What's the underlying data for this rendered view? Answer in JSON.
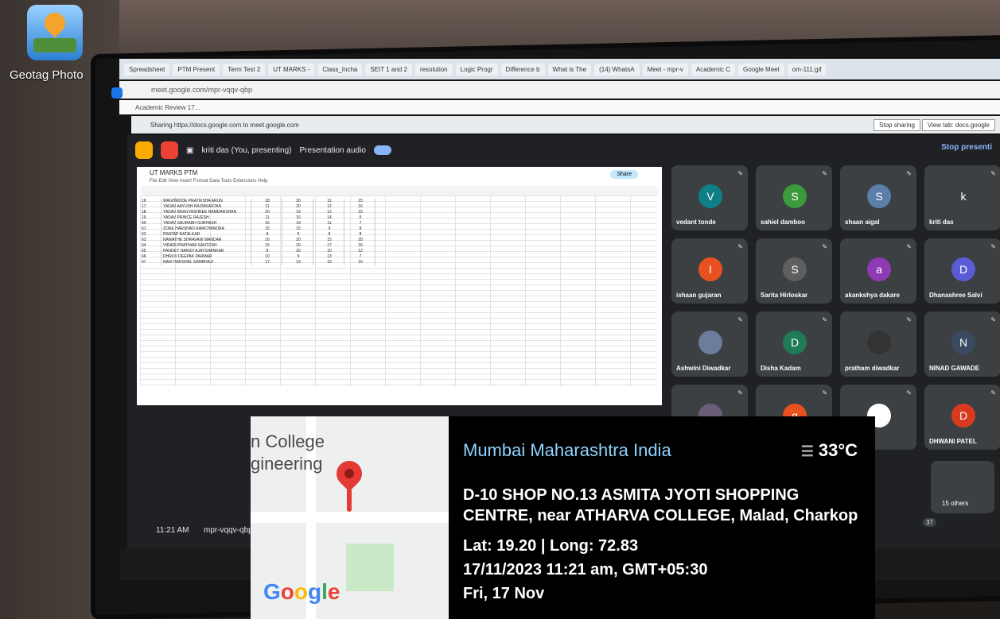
{
  "desktop": {
    "app_label": "Geotag Photo"
  },
  "browser": {
    "tabs": [
      "Spreadsheet",
      "PTM Present",
      "Term Test 2",
      "UT MARKS -",
      "Class_Incha",
      "SEIT 1 and 2",
      "resolution",
      "Logic Progr",
      "Difference b",
      "What is The",
      "(14) WhatsA",
      "Meet - mpr-v",
      "Academic C",
      "Google Meet",
      "om-111.gif"
    ],
    "url": "meet.google.com/mpr-vqqv-qbp",
    "bookmark": "Academic Review 17...",
    "sharing_text": "Sharing https://docs.google.com to meet.google.com",
    "stop_sharing": "Stop sharing",
    "view_tab": "View tab: docs.google"
  },
  "meet": {
    "presenter": "kriti das (You, presenting)",
    "presentation_audio": "Presentation audio",
    "stop_presenting": "Stop presenti",
    "time": "11:21 AM",
    "meeting_code": "mpr-vqqv-qbp",
    "participant_count": "37",
    "others": "15 others",
    "participants": [
      {
        "name": "vedant tonde",
        "initial": "V",
        "color": "#0f7f86"
      },
      {
        "name": "sahiel damboo",
        "initial": "S",
        "color": "#3c9a3c"
      },
      {
        "name": "shaan aigal",
        "initial": "S",
        "color": "#5b7fa8"
      },
      {
        "name": "kriti das",
        "initial": "k",
        "color": "#3c4043"
      },
      {
        "name": "ishaan gujaran",
        "initial": "I",
        "color": "#e8501f"
      },
      {
        "name": "Sarita Hirloskar",
        "initial": "S",
        "color": "#5f5f5f"
      },
      {
        "name": "akankshya dakare",
        "initial": "a",
        "color": "#8e3ab5"
      },
      {
        "name": "Dhanashree Salvi",
        "initial": "D",
        "color": "#5b5bd6"
      },
      {
        "name": "Ashwini Diwadkar",
        "initial": "",
        "color": "#6b7d9a"
      },
      {
        "name": "Disha Kadam",
        "initial": "D",
        "color": "#1f7a55"
      },
      {
        "name": "pratham diwadkar",
        "initial": "",
        "color": "#333333"
      },
      {
        "name": "NINAD GAWADE",
        "initial": "N",
        "color": "#3a4a60"
      },
      {
        "name": "",
        "initial": "",
        "color": "#6b5e7a"
      },
      {
        "name": "",
        "initial": "g",
        "color": "#e8501f"
      },
      {
        "name": "",
        "initial": "",
        "color": "#ffffff"
      },
      {
        "name": "DHWANI PATEL",
        "initial": "D",
        "color": "#d93a1f"
      }
    ]
  },
  "sheet": {
    "title": "UT MARKS PTM",
    "menu": "File  Edit  View  Insert  Format  Data  Tools  Extensions  Help",
    "share": "Share",
    "rows": [
      [
        "16",
        "WAGHMODE PRATIKSHA ARUN",
        "18",
        "20",
        "11",
        "15"
      ],
      [
        "17",
        "YADAV AAYUSH RAJNIKANTAN",
        "11",
        "20",
        "12",
        "16"
      ],
      [
        "18",
        "YADAV BHAGYASHREE RAMDARSHAN",
        "20",
        "19",
        "12",
        "15"
      ],
      [
        "19",
        "YADAV PRINCE RAJESH",
        "11",
        "16",
        "14",
        "5"
      ],
      [
        "60",
        "YADAV SAURABH SUBHASH",
        "16",
        "19",
        "11",
        "7"
      ],
      [
        "61",
        "ZORE HARSHAD RAMCHANDRA",
        "15",
        "15",
        "9",
        "8"
      ],
      [
        "62",
        "PRATAP NATALKAR",
        "8",
        "5",
        "8",
        "8"
      ],
      [
        "63",
        "NAWATHE SHRAVANI MANDAR",
        "16",
        "20",
        "15",
        "20"
      ],
      [
        "64",
        "VIRADI PRATHAM SANTOSH",
        "15",
        "20",
        "17",
        "16"
      ],
      [
        "65",
        "PANDEY HARSH AJAYSHANKAR",
        "8",
        "20",
        "10",
        "12"
      ],
      [
        "66",
        "DHRUV DEEPAK PARMAR",
        "10",
        "9",
        "13",
        "7"
      ],
      [
        "67",
        "NAIK HARSHAL SAMBHAJI",
        "17",
        "19",
        "15",
        "16"
      ]
    ]
  },
  "geotag": {
    "map_text_1": "n College",
    "map_text_2": "gineering",
    "google": [
      "G",
      "o",
      "o",
      "g",
      "l",
      "e"
    ],
    "city": "Mumbai Maharashtra India",
    "temperature": "33°C",
    "address": "D-10 SHOP NO.13 ASMITA JYOTI SHOPPING CENTRE, near ATHARVA COLLEGE, Malad, Charkop",
    "latlong": "Lat: 19.20 | Long: 72.83",
    "datetime": "17/11/2023  11:21 am, GMT+05:30",
    "day": "Fri, 17 Nov"
  }
}
